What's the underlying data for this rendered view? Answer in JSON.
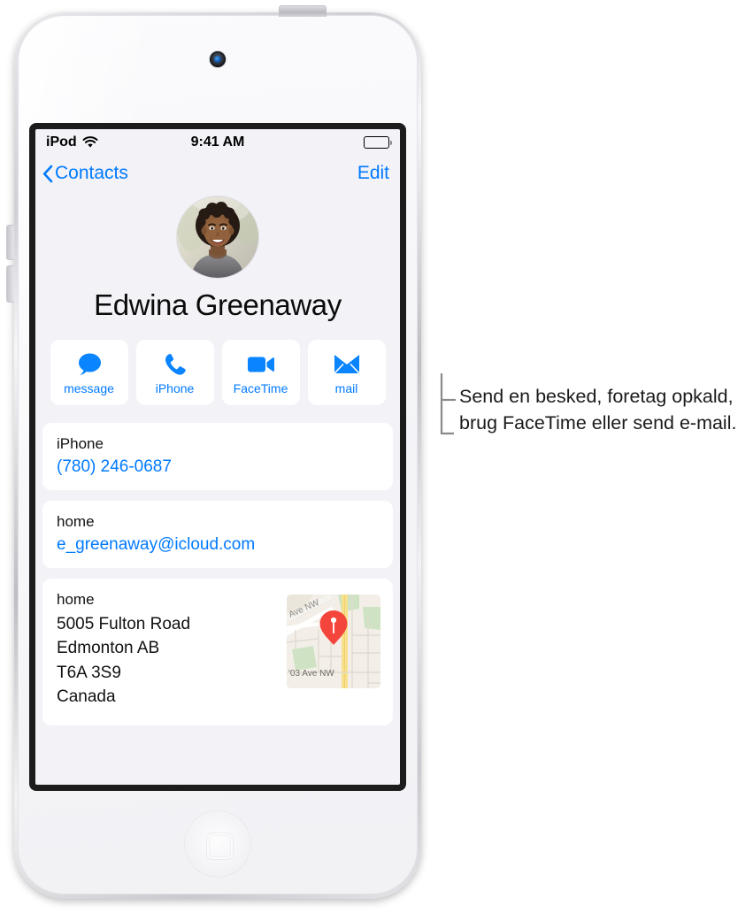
{
  "device": {
    "name": "iPod touch",
    "camera_icon": "front-camera",
    "home_button_icon": "home-square-icon"
  },
  "statusbar": {
    "carrier": "iPod",
    "wifi_icon": "wifi-icon",
    "time": "9:41 AM",
    "battery_icon": "battery-full-icon"
  },
  "navbar": {
    "back_icon": "chevron-left-icon",
    "back_label": "Contacts",
    "edit_label": "Edit"
  },
  "contact": {
    "avatar_icon": "contact-photo",
    "name": "Edwina Greenaway",
    "actions": [
      {
        "label": "message",
        "icon": "message-bubble-icon"
      },
      {
        "label": "iPhone",
        "icon": "phone-handset-icon"
      },
      {
        "label": "FaceTime",
        "icon": "video-camera-icon"
      },
      {
        "label": "mail",
        "icon": "envelope-icon"
      }
    ],
    "phone": {
      "label": "iPhone",
      "value": "(780) 246-0687"
    },
    "email": {
      "label": "home",
      "value": "e_greenaway@icloud.com"
    },
    "address": {
      "label": "home",
      "street": "5005 Fulton Road",
      "city": "Edmonton AB",
      "postal": "T6A 3S9",
      "country": "Canada",
      "map_icon": "map-pin-icon",
      "map_street_1": "Ave NW",
      "map_street_2": "'03 Ave NW"
    }
  },
  "callout": {
    "text": "Send en besked, foretag opkald, brug FaceTime eller send e-mail.",
    "bracket_icon": "callout-bracket"
  },
  "colors": {
    "accent_blue": "#007aff",
    "screen_bg": "#f2f2f7",
    "card_bg": "#ffffff",
    "pin_red": "#f4453c"
  }
}
